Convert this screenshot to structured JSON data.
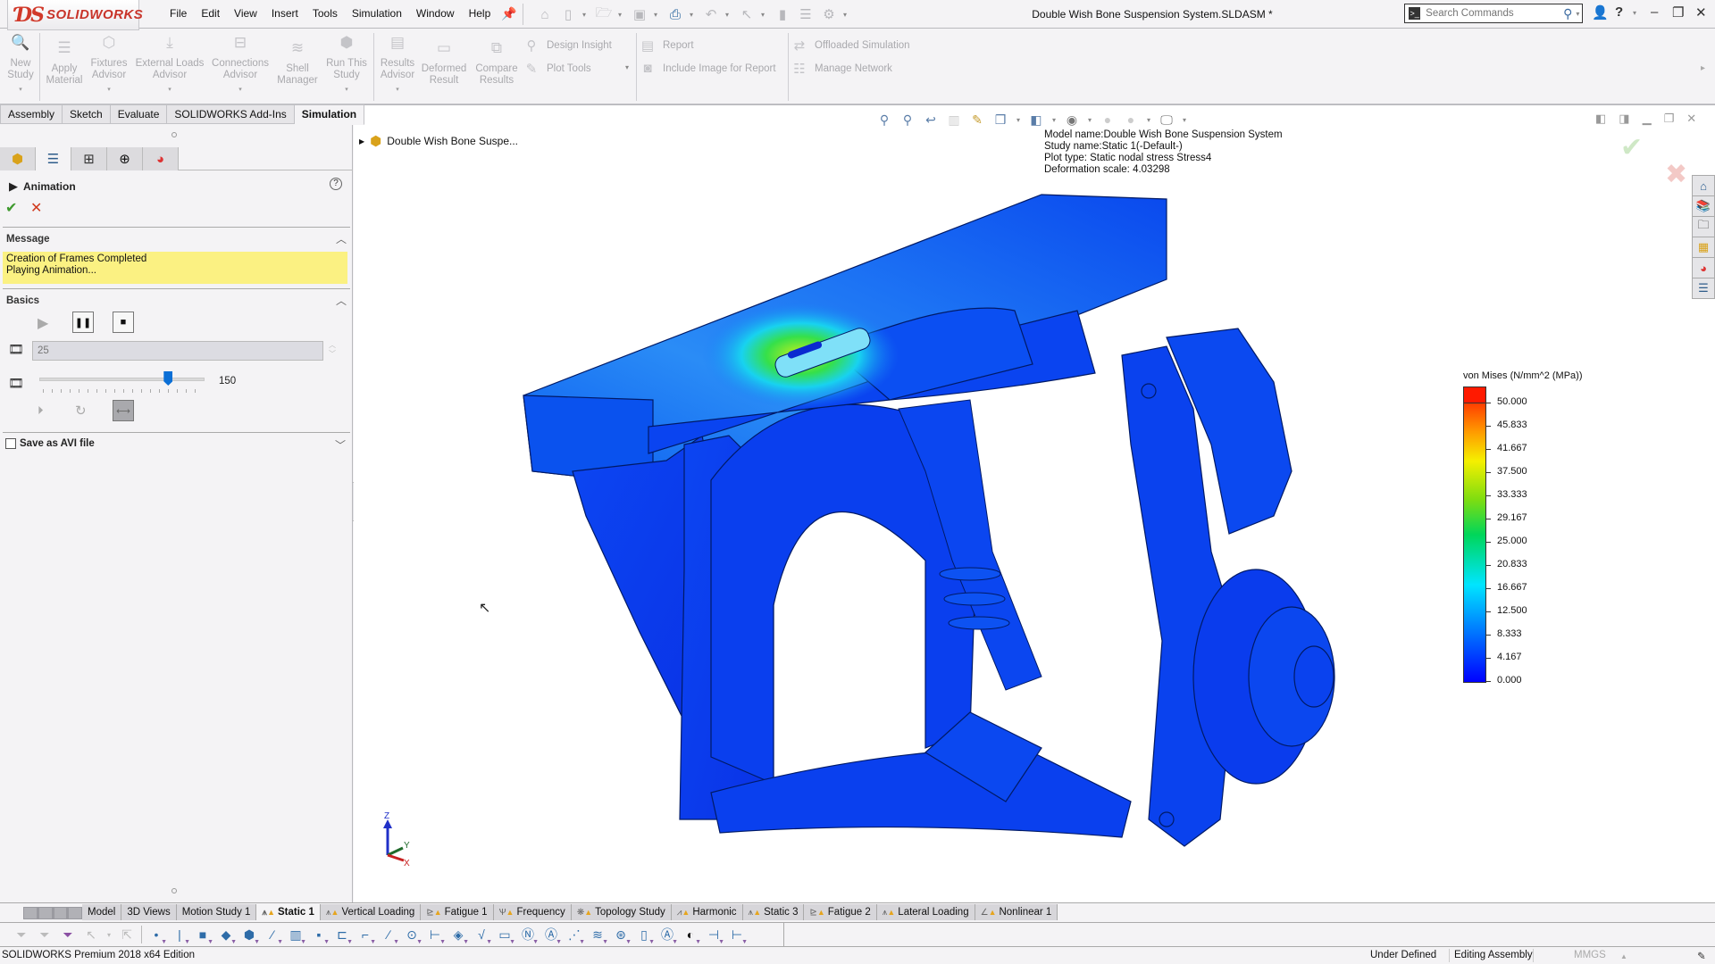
{
  "app": {
    "brand": "SOLIDWORKS",
    "document_title": "Double Wish Bone Suspension System.SLDASM *"
  },
  "menu": [
    "File",
    "Edit",
    "View",
    "Insert",
    "Tools",
    "Simulation",
    "Window",
    "Help"
  ],
  "search": {
    "placeholder": "Search Commands"
  },
  "command_manager": {
    "buttons": [
      {
        "label": "New Study",
        "icon": "new-study-icon"
      },
      {
        "label": "Apply Material",
        "icon": "apply-material-icon"
      },
      {
        "label": "Fixtures Advisor",
        "icon": "fixtures-icon"
      },
      {
        "label": "External Loads Advisor",
        "icon": "external-loads-icon"
      },
      {
        "label": "Connections Advisor",
        "icon": "connections-icon"
      },
      {
        "label": "Shell Manager",
        "icon": "shell-manager-icon"
      },
      {
        "label": "Run This Study",
        "icon": "run-study-icon"
      },
      {
        "label": "Results Advisor",
        "icon": "results-advisor-icon"
      },
      {
        "label": "Deformed Result",
        "icon": "deformed-result-icon"
      },
      {
        "label": "Compare Results",
        "icon": "compare-results-icon"
      }
    ],
    "rows": [
      {
        "label": "Design Insight",
        "icon": "design-insight-icon"
      },
      {
        "label": "Plot Tools",
        "icon": "plot-tools-icon"
      },
      {
        "label": "Report",
        "icon": "report-icon"
      },
      {
        "label": "Include Image for Report",
        "icon": "camera-icon"
      },
      {
        "label": "Offloaded Simulation",
        "icon": "offload-icon"
      },
      {
        "label": "Manage Network",
        "icon": "network-icon"
      }
    ],
    "tabs": [
      {
        "label": "Assembly",
        "active": false
      },
      {
        "label": "Sketch",
        "active": false
      },
      {
        "label": "Evaluate",
        "active": false
      },
      {
        "label": "SOLIDWORKS Add-Ins",
        "active": false
      },
      {
        "label": "Simulation",
        "active": true
      }
    ]
  },
  "property_manager": {
    "title": "Animation",
    "help": "?",
    "message_group": "Message",
    "message_lines": [
      "Creation of Frames Completed",
      "Playing Animation..."
    ],
    "basics_group": "Basics",
    "frames_value": "25",
    "speed_value": "150",
    "speed_slider_fraction": 0.78,
    "save_avi_label": "Save as AVI file",
    "save_avi_checked": false
  },
  "graphics": {
    "tree_root": "Double Wish Bone Suspe...",
    "plot_info": [
      "Model name:Double Wish Bone Suspension System",
      "Study name:Static 1(-Default-)",
      "Plot type: Static nodal stress Stress4",
      "Deformation scale: 4.03298"
    ],
    "legend": {
      "title": "von Mises (N/mm^2 (MPa))",
      "labels": [
        "50.000",
        "45.833",
        "41.667",
        "37.500",
        "33.333",
        "29.167",
        "25.000",
        "20.833",
        "16.667",
        "12.500",
        "8.333",
        "4.167",
        "0.000"
      ],
      "min": 0.0,
      "max": 50.0
    },
    "triad": {
      "x": "X",
      "y": "Y",
      "z": "Z"
    }
  },
  "study_tabs": [
    {
      "label": "Model",
      "active": false,
      "icon": ""
    },
    {
      "label": "3D Views",
      "active": false,
      "icon": ""
    },
    {
      "label": "Motion Study 1",
      "active": false,
      "icon": ""
    },
    {
      "label": "Static 1",
      "active": true,
      "icon": "static-study-icon"
    },
    {
      "label": "Vertical Loading",
      "active": false,
      "icon": "static-study-icon"
    },
    {
      "label": "Fatigue 1",
      "active": false,
      "icon": "fatigue-study-icon"
    },
    {
      "label": "Frequency",
      "active": false,
      "icon": "frequency-study-icon"
    },
    {
      "label": "Topology Study",
      "active": false,
      "icon": "topology-study-icon"
    },
    {
      "label": "Harmonic",
      "active": false,
      "icon": "harmonic-study-icon"
    },
    {
      "label": "Static 3",
      "active": false,
      "icon": "static-study-icon"
    },
    {
      "label": "Fatigue 2",
      "active": false,
      "icon": "fatigue-study-icon"
    },
    {
      "label": "Lateral Loading",
      "active": false,
      "icon": "static-study-icon"
    },
    {
      "label": "Nonlinear 1",
      "active": false,
      "icon": "nonlinear-study-icon"
    }
  ],
  "status_bar": {
    "edition": "SOLIDWORKS Premium 2018 x64 Edition",
    "definition": "Under Defined",
    "mode": "Editing Assembly",
    "units": "MMGS"
  },
  "colors": {
    "brand_red": "#c8342a",
    "message_yellow": "#fbf182",
    "slider_blue": "#0b6fd6",
    "stress_low": "#0000ff",
    "stress_high": "#ff0000"
  }
}
